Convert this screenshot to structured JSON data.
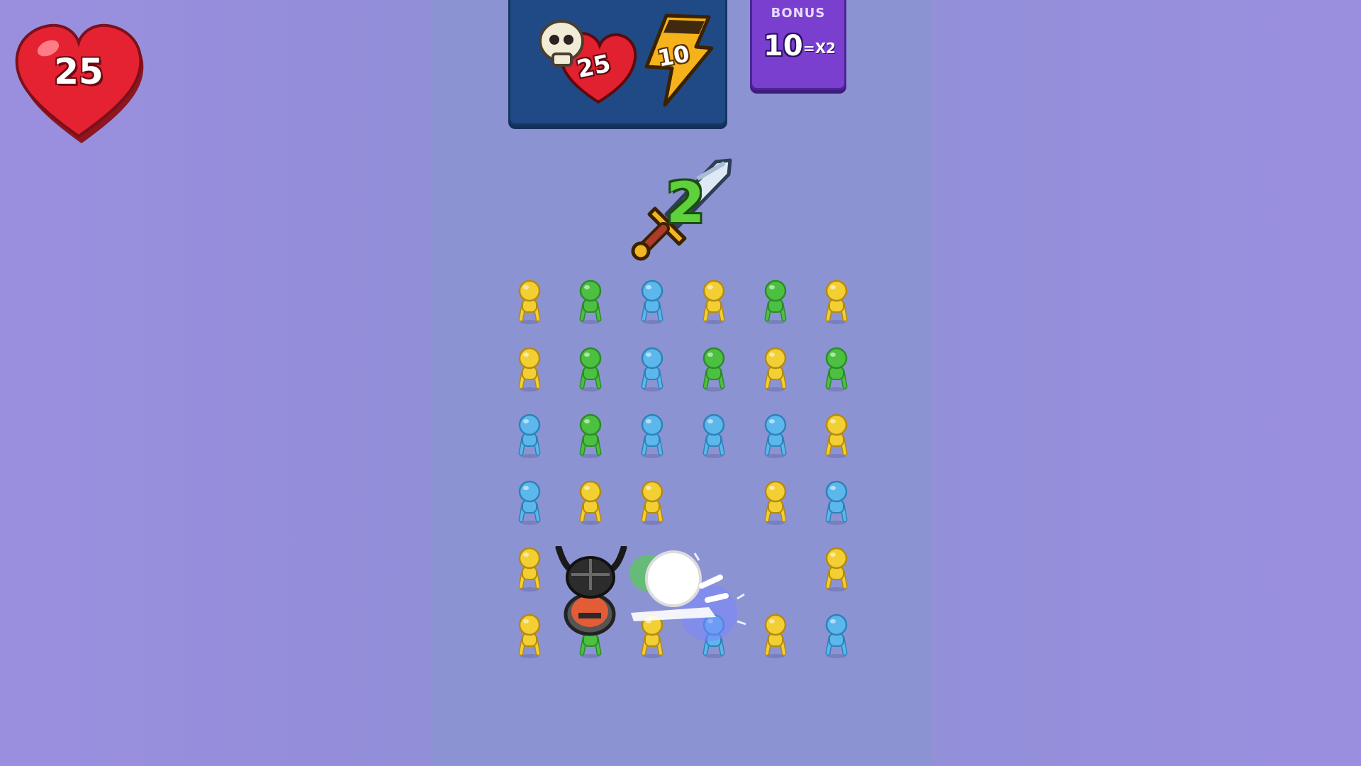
{
  "hud": {
    "lives": "25",
    "enemy_health": "25",
    "energy": "10",
    "sword_power": "2"
  },
  "bonus": {
    "title": "BONUS",
    "value": "10",
    "multiplier": "=X2"
  },
  "colors": {
    "yellow": "#f2cf33",
    "green": "#4cc041",
    "blue": "#5cb8ec",
    "background": "#9490dc",
    "play_area": "#8c93d2"
  },
  "grid": {
    "rows": [
      [
        "yellow",
        "green",
        "blue",
        "yellow",
        "green",
        "yellow"
      ],
      [
        "yellow",
        "green",
        "blue",
        "green",
        "yellow",
        "green"
      ],
      [
        "blue",
        "green",
        "blue",
        "blue",
        "blue",
        "yellow"
      ],
      [
        "blue",
        "yellow",
        "yellow",
        "empty",
        "yellow",
        "blue"
      ],
      [
        "yellow",
        "empty",
        "empty",
        "empty",
        "empty",
        "yellow"
      ],
      [
        "yellow",
        "green",
        "yellow",
        "blue",
        "yellow",
        "blue"
      ]
    ]
  },
  "icons": {
    "lives": "heart-icon",
    "enemy": "skull-heart-icon",
    "energy": "lightning-bolt-icon",
    "weapon": "sword-icon",
    "player": "viking-helmet-icon"
  }
}
